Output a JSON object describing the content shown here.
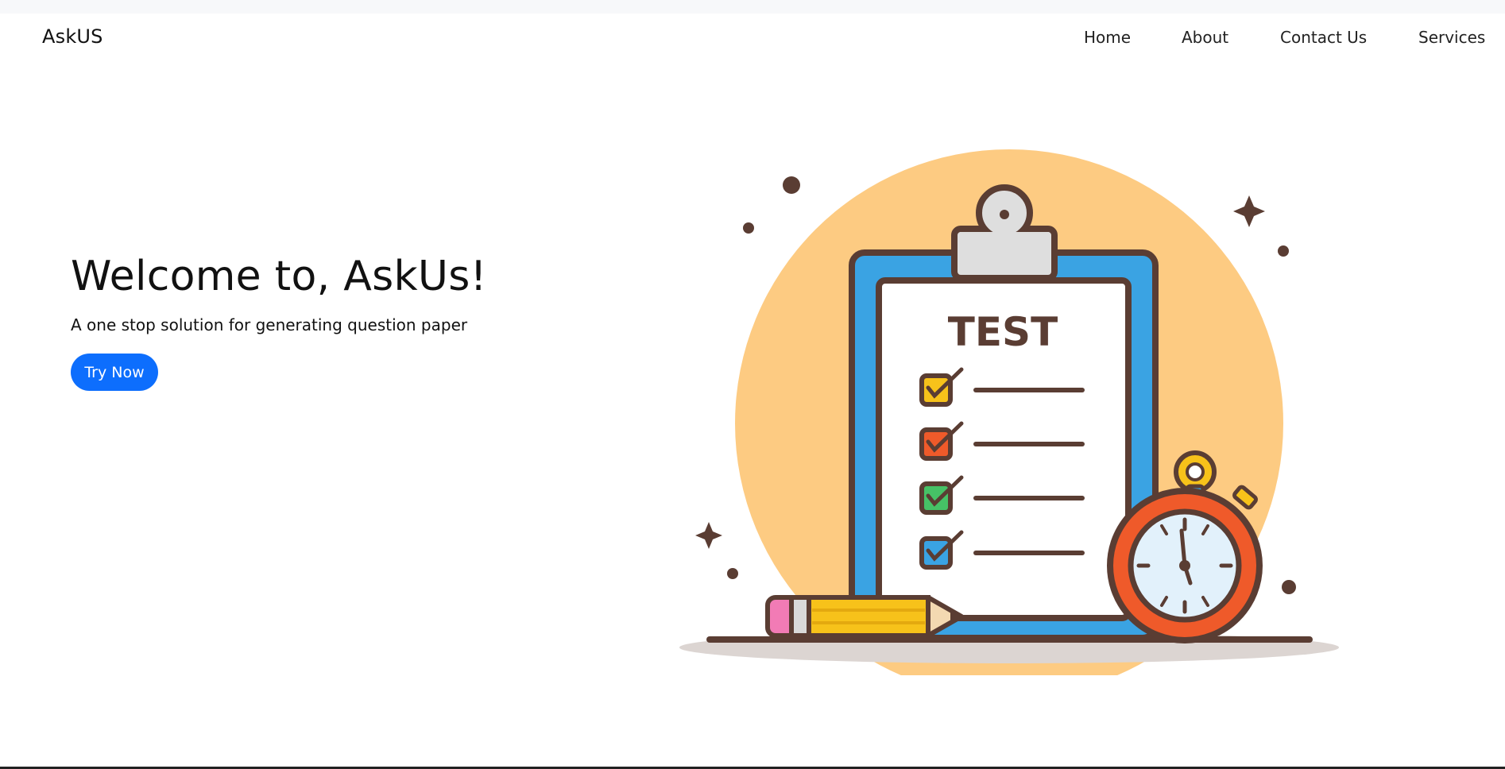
{
  "navbar": {
    "brand": "AskUS",
    "links": [
      {
        "label": "Home"
      },
      {
        "label": "About"
      },
      {
        "label": "Contact Us"
      },
      {
        "label": "Services"
      }
    ]
  },
  "hero": {
    "title": "Welcome to, AskUs!",
    "subtitle": "A one stop solution for generating question paper",
    "cta_label": "Try Now"
  },
  "illustration": {
    "heading": "TEST",
    "icon": "clipboard-test-illustration",
    "colors": {
      "primary": "#0d6efd",
      "circle": "#fdcb82",
      "clipboard": "#3aa3e3",
      "outline": "#5a3d33",
      "stopwatch": "#ef5a2a",
      "pencil": "#f7c21a"
    }
  }
}
